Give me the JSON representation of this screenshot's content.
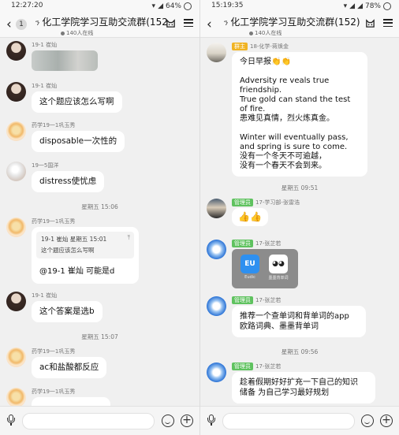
{
  "left": {
    "status": {
      "time": "12:27:20",
      "battery": "64%"
    },
    "header": {
      "back_badge": "1",
      "title": "化工学院学习互助交流群(152)",
      "online": "140人在线"
    },
    "messages": [
      {
        "type": "image",
        "sender": "19-1 崔灿"
      },
      {
        "type": "text",
        "sender": "19-1 崔灿",
        "text": "这个题应该怎么写啊"
      },
      {
        "type": "text",
        "sender": "药学19一1巩玉秀",
        "text": "disposable一次性的"
      },
      {
        "type": "text",
        "sender": "19一5国洋",
        "text": "distress使忧虑"
      },
      {
        "type": "time",
        "text": "星期五 15:06"
      },
      {
        "type": "quote",
        "sender": "药学19一1巩玉秀",
        "quote_head": "19-1 崔灿  星期五 15:01",
        "quote_text": "这个题应该怎么写啊",
        "reply": "@19-1 崔灿 可能是d"
      },
      {
        "type": "text",
        "sender": "19-1 崔灿",
        "text": "这个答案是选b"
      },
      {
        "type": "time",
        "text": "星期五 15:07"
      },
      {
        "type": "text",
        "sender": "药学19一1巩玉秀",
        "text": "ac和盐酸都反应"
      },
      {
        "type": "partial",
        "sender": "药学19一1巩玉秀"
      }
    ]
  },
  "right": {
    "status": {
      "time": "15:19:35",
      "battery": "78%"
    },
    "header": {
      "title": "化工学院学习互助交流群(152)",
      "online": "140人在线"
    },
    "messages": [
      {
        "type": "text",
        "role": "群主",
        "sender": "18-化学-蒋焕金",
        "text": "今日早报👏👏\n\nAdversity re veals true friendship.\nTrue gold can stand the test of fire.\n患难见真情，烈火炼真金。\n\nWinter will eventually pass,\nand spring is sure to come.\n没有一个冬天不可逾越，\n没有一个春天不会到来。"
      },
      {
        "type": "time",
        "text": "星期五 09:51"
      },
      {
        "type": "emoji",
        "role": "管理员",
        "sender": "17-学习部-张雷浩",
        "text": "👍👍"
      },
      {
        "type": "apps",
        "role": "管理员",
        "sender": "17-张芷若",
        "apps": [
          {
            "name": "Eudic",
            "glyph": "EU"
          },
          {
            "name": "墨墨背单词",
            "glyph": "◕◕"
          }
        ]
      },
      {
        "type": "text",
        "role": "管理员",
        "sender": "17-张芷若",
        "text": "推荐一个查单词和背单词的app\n欧路词典、墨墨背单词"
      },
      {
        "type": "time",
        "text": "星期五 09:56"
      },
      {
        "type": "text",
        "role": "管理员",
        "sender": "17-张芷若",
        "text": "趁着假期好好扩充一下自己的知识\n储备 为自己学习最好规划"
      }
    ]
  }
}
